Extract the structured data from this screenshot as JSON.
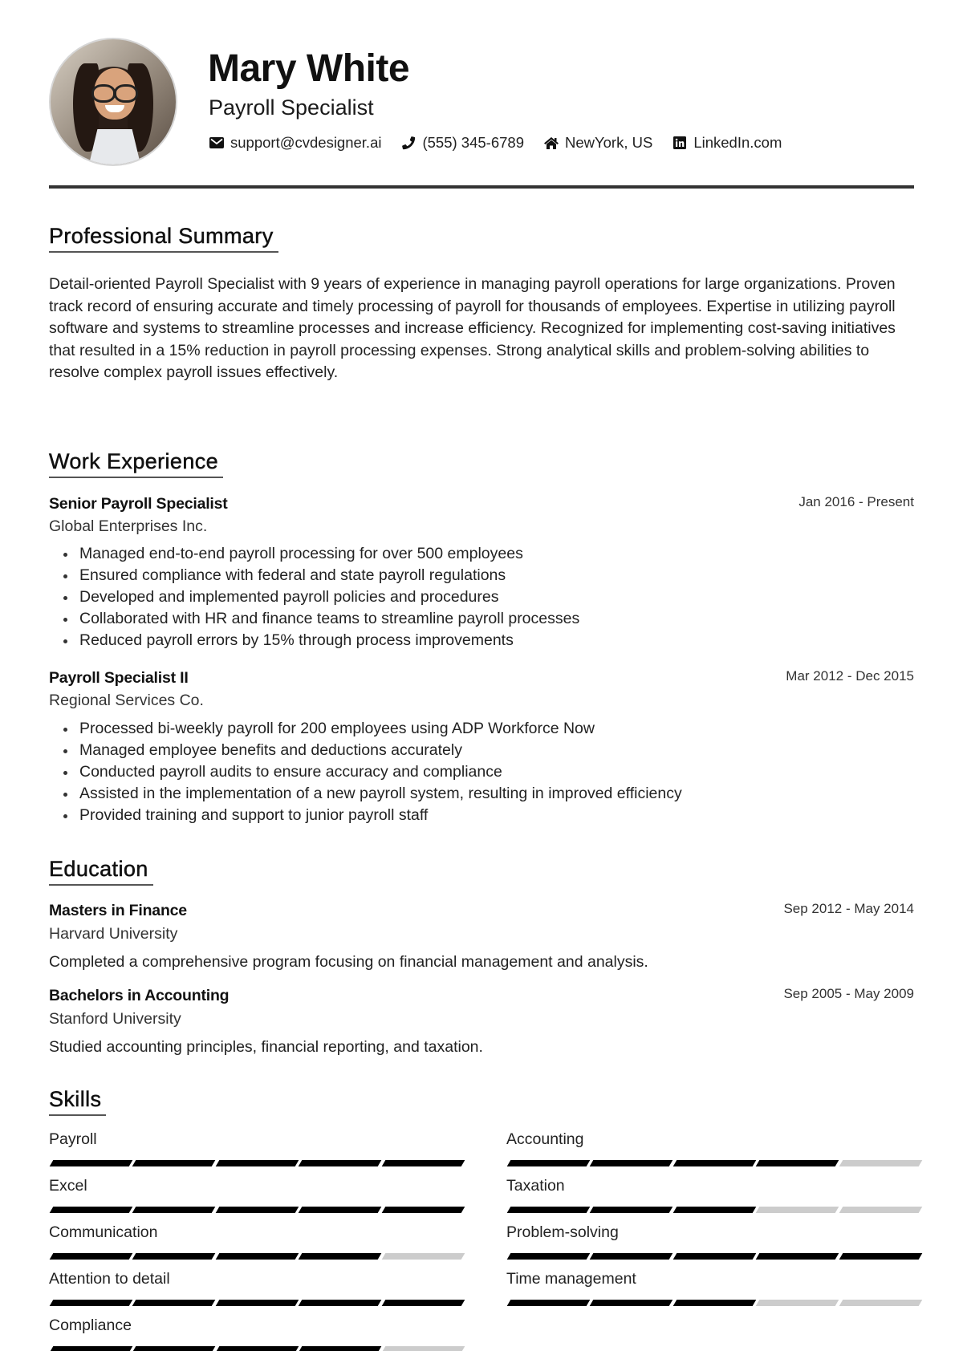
{
  "header": {
    "name": "Mary White",
    "title": "Payroll Specialist",
    "contacts": [
      {
        "icon": "envelope-icon",
        "text": "support@cvdesigner.ai"
      },
      {
        "icon": "phone-icon",
        "text": "(555) 345-6789"
      },
      {
        "icon": "home-icon",
        "text": "NewYork, US"
      },
      {
        "icon": "linkedin-icon",
        "text": "LinkedIn.com"
      }
    ]
  },
  "summary": {
    "heading": "Professional Summary",
    "text": "Detail-oriented Payroll Specialist with 9 years of experience in managing payroll operations for large organizations. Proven track record of ensuring accurate and timely processing of payroll for thousands of employees. Expertise in utilizing payroll software and systems to streamline processes and increase efficiency. Recognized for implementing cost-saving initiatives that resulted in a 15% reduction in payroll processing expenses. Strong analytical skills and problem-solving abilities to resolve complex payroll issues effectively."
  },
  "experience": {
    "heading": "Work Experience",
    "jobs": [
      {
        "title": "Senior Payroll Specialist",
        "company": "Global Enterprises Inc.",
        "dates": "Jan 2016 - Present",
        "bullets": [
          "Managed end-to-end payroll processing for over 500 employees",
          "Ensured compliance with federal and state payroll regulations",
          "Developed and implemented payroll policies and procedures",
          "Collaborated with HR and finance teams to streamline payroll processes",
          "Reduced payroll errors by 15% through process improvements"
        ]
      },
      {
        "title": "Payroll Specialist II",
        "company": "Regional Services Co.",
        "dates": "Mar 2012 - Dec 2015",
        "bullets": [
          "Processed bi-weekly payroll for 200 employees using ADP Workforce Now",
          "Managed employee benefits and deductions accurately",
          "Conducted payroll audits to ensure accuracy and compliance",
          "Assisted in the implementation of a new payroll system, resulting in improved efficiency",
          "Provided training and support to junior payroll staff"
        ]
      }
    ]
  },
  "education": {
    "heading": "Education",
    "items": [
      {
        "degree": "Masters in Finance",
        "school": "Harvard University",
        "dates": "Sep 2012 - May 2014",
        "description": "Completed a comprehensive program focusing on financial management and analysis."
      },
      {
        "degree": "Bachelors in Accounting",
        "school": "Stanford University",
        "dates": "Sep 2005 - May 2009",
        "description": "Studied accounting principles, financial reporting, and taxation."
      }
    ]
  },
  "skills": {
    "heading": "Skills",
    "max_level": 5,
    "items": [
      {
        "name": "Payroll",
        "level": 5
      },
      {
        "name": "Accounting",
        "level": 4
      },
      {
        "name": "Excel",
        "level": 5
      },
      {
        "name": "Taxation",
        "level": 3
      },
      {
        "name": "Communication",
        "level": 4
      },
      {
        "name": "Problem-solving",
        "level": 5
      },
      {
        "name": "Attention to detail",
        "level": 5
      },
      {
        "name": "Time management",
        "level": 3
      },
      {
        "name": "Compliance",
        "level": 4
      }
    ]
  },
  "colors": {
    "text": "#222222",
    "divider": "#333333",
    "skill_filled": "#000000",
    "skill_empty": "#cccccc"
  }
}
